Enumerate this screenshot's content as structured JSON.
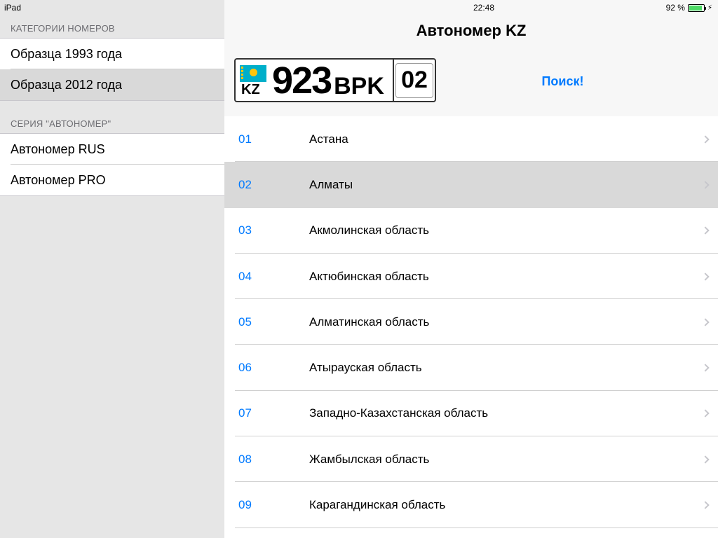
{
  "status": {
    "device": "iPad",
    "time": "22:48",
    "battery": "92 %",
    "battery_level": 0.92
  },
  "sidebar": {
    "sections": [
      {
        "header": "КАТЕГОРИИ НОМЕРОВ",
        "items": [
          {
            "label": "Образца 1993 года",
            "selected": false
          },
          {
            "label": "Образца 2012 года",
            "selected": true
          }
        ]
      },
      {
        "header": "СЕРИЯ \"АВТОНОМЕР\"",
        "items": [
          {
            "label": "Автономер RUS",
            "selected": false
          },
          {
            "label": "Автономер PRO",
            "selected": false
          }
        ]
      }
    ]
  },
  "main": {
    "title": "Автономер KZ",
    "plate": {
      "country": "KZ",
      "number": "923",
      "letters": "BPK",
      "region": "02"
    },
    "search_label": "Поиск!",
    "regions": [
      {
        "code": "01",
        "name": "Астана",
        "selected": false
      },
      {
        "code": "02",
        "name": "Алматы",
        "selected": true
      },
      {
        "code": "03",
        "name": "Акмолинская область",
        "selected": false
      },
      {
        "code": "04",
        "name": "Актюбинская область",
        "selected": false
      },
      {
        "code": "05",
        "name": "Алматинская область",
        "selected": false
      },
      {
        "code": "06",
        "name": "Атырауская область",
        "selected": false
      },
      {
        "code": "07",
        "name": "Западно-Казахстанская область",
        "selected": false
      },
      {
        "code": "08",
        "name": "Жамбылская область",
        "selected": false
      },
      {
        "code": "09",
        "name": "Карагандинская область",
        "selected": false
      }
    ]
  },
  "colors": {
    "accent": "#007aff",
    "selected_row": "#d9d9d9",
    "sidebar_bg": "#e6e6e6",
    "battery": "#4cd964"
  }
}
